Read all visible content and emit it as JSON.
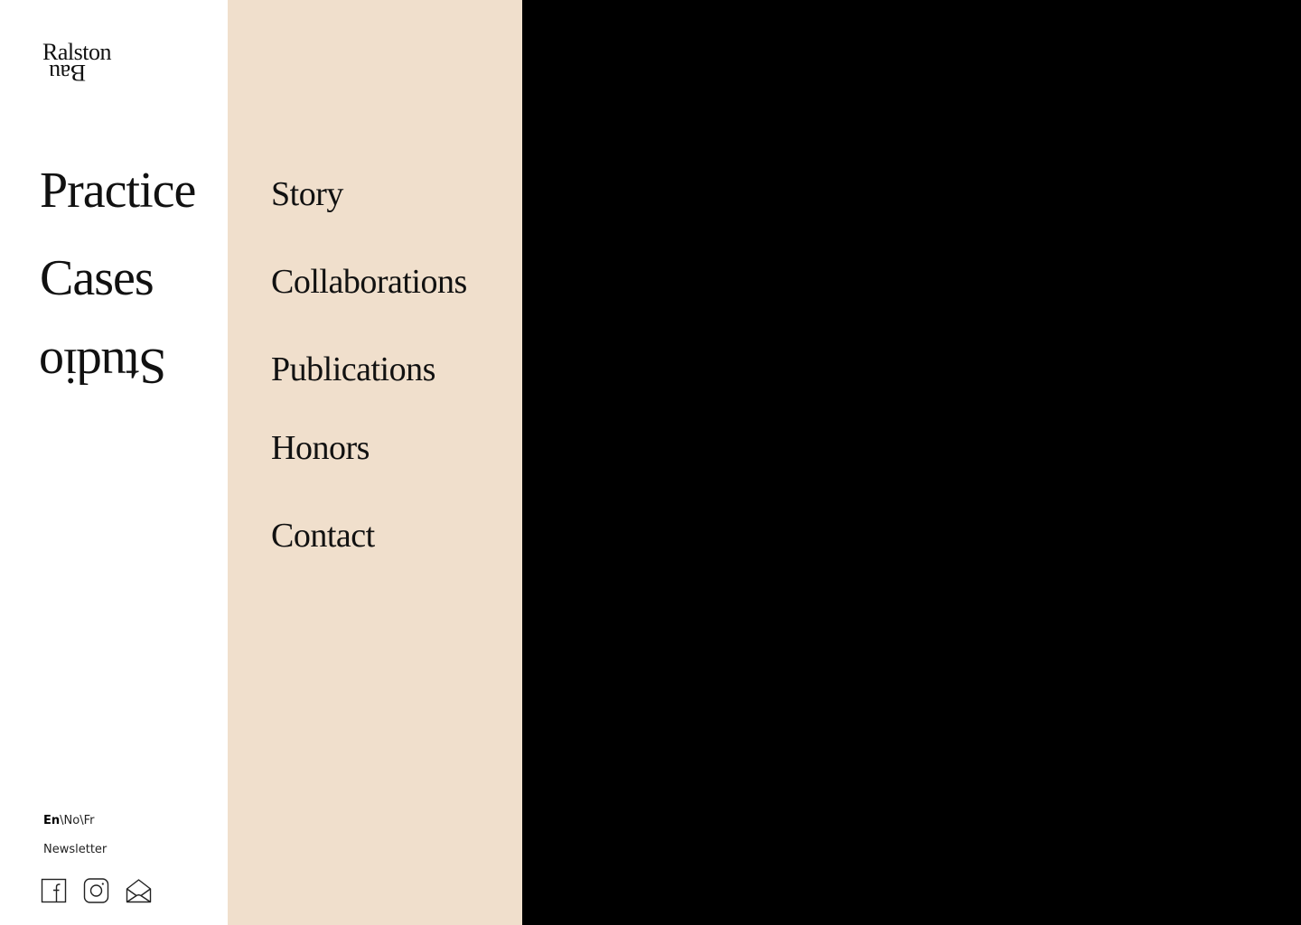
{
  "logo": {
    "line1": "Ralston",
    "line2": "Bau"
  },
  "main_nav": [
    {
      "label": "Practice"
    },
    {
      "label": "Cases"
    },
    {
      "label": "Studio",
      "flipped": true
    }
  ],
  "sub_nav": [
    {
      "label": "Story"
    },
    {
      "label": "Collaborations"
    },
    {
      "label": "Publications"
    },
    {
      "label": "Honors"
    },
    {
      "label": "Contact"
    }
  ],
  "footer": {
    "languages": [
      {
        "label": "En",
        "active": true
      },
      {
        "label": "No",
        "active": false
      },
      {
        "label": "Fr",
        "active": false
      }
    ],
    "language_separator": "\\",
    "newsletter_label": "Newsletter",
    "social_icons": [
      "facebook-icon",
      "instagram-icon",
      "email-icon"
    ]
  },
  "colors": {
    "left_panel": "#ffffff",
    "sub_panel": "#f0dfcc",
    "right_panel": "#000000",
    "text": "#111111"
  }
}
